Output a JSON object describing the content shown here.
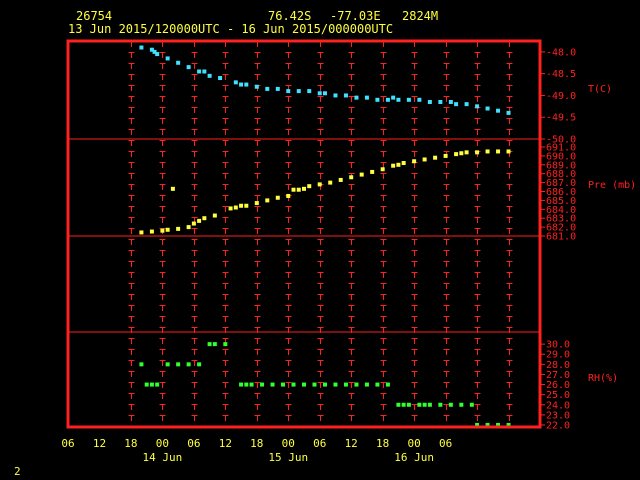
{
  "header": {
    "station_id": "26754",
    "lat": "76.42S",
    "lon": "-77.03E",
    "elev": "2824M",
    "period": "13 Jun 2015/120000UTC - 16 Jun 2015/000000UTC"
  },
  "footer": {
    "page_number": "2"
  },
  "colors": {
    "frame": "#ff2020",
    "grid": "#ff2020",
    "text": "#ffff40",
    "temperature": "#40e0ff",
    "pressure": "#ffff40",
    "rh": "#30ff30"
  },
  "chart_data": [
    {
      "type": "scatter",
      "title": "",
      "ylabel": "T(C)",
      "ylim": [
        -50.0,
        -47.75
      ],
      "y_ticks": [
        "-48.0",
        "-48.5",
        "-49.0",
        "-49.5",
        "-50.0"
      ],
      "color": "#40e0ff",
      "points": [
        [
          14,
          -47.9
        ],
        [
          16,
          -47.95
        ],
        [
          16.5,
          -48.0
        ],
        [
          17,
          -48.05
        ],
        [
          19,
          -48.15
        ],
        [
          21,
          -48.25
        ],
        [
          23,
          -48.35
        ],
        [
          25,
          -48.45
        ],
        [
          26,
          -48.45
        ],
        [
          27,
          -48.55
        ],
        [
          29,
          -48.6
        ],
        [
          32,
          -48.7
        ],
        [
          33,
          -48.75
        ],
        [
          34,
          -48.75
        ],
        [
          36,
          -48.8
        ],
        [
          38,
          -48.85
        ],
        [
          40,
          -48.85
        ],
        [
          42,
          -48.9
        ],
        [
          44,
          -48.9
        ],
        [
          46,
          -48.9
        ],
        [
          48,
          -48.95
        ],
        [
          49,
          -48.95
        ],
        [
          51,
          -49.0
        ],
        [
          53,
          -49.0
        ],
        [
          55,
          -49.05
        ],
        [
          57,
          -49.05
        ],
        [
          59,
          -49.1
        ],
        [
          61,
          -49.1
        ],
        [
          62,
          -49.05
        ],
        [
          63,
          -49.1
        ],
        [
          65,
          -49.1
        ],
        [
          67,
          -49.1
        ],
        [
          69,
          -49.15
        ],
        [
          71,
          -49.15
        ],
        [
          73,
          -49.15
        ],
        [
          74,
          -49.2
        ],
        [
          76,
          -49.2
        ],
        [
          78,
          -49.25
        ],
        [
          80,
          -49.3
        ],
        [
          82,
          -49.35
        ],
        [
          84,
          -49.4
        ]
      ]
    },
    {
      "type": "scatter",
      "title": "",
      "ylabel": "Pre (mb)",
      "ylim": [
        681.0,
        691.9
      ],
      "y_ticks": [
        "691.0",
        "690.0",
        "689.0",
        "688.0",
        "687.0",
        "686.0",
        "685.0",
        "684.0",
        "683.0",
        "682.0",
        "681.0"
      ],
      "color": "#ffff40",
      "points": [
        [
          14,
          681.4
        ],
        [
          16,
          681.5
        ],
        [
          18,
          681.6
        ],
        [
          19,
          681.7
        ],
        [
          21,
          681.8
        ],
        [
          23,
          682.0
        ],
        [
          20,
          686.3
        ],
        [
          24,
          682.4
        ],
        [
          25,
          682.7
        ],
        [
          26,
          683.0
        ],
        [
          28,
          683.3
        ],
        [
          31,
          684.1
        ],
        [
          32,
          684.2
        ],
        [
          33,
          684.4
        ],
        [
          34,
          684.4
        ],
        [
          36,
          684.7
        ],
        [
          38,
          685.0
        ],
        [
          40,
          685.3
        ],
        [
          42,
          685.5
        ],
        [
          43,
          686.2
        ],
        [
          44,
          686.2
        ],
        [
          45,
          686.3
        ],
        [
          46,
          686.6
        ],
        [
          48,
          686.8
        ],
        [
          50,
          687.0
        ],
        [
          52,
          687.3
        ],
        [
          54,
          687.6
        ],
        [
          56,
          687.9
        ],
        [
          58,
          688.2
        ],
        [
          60,
          688.5
        ],
        [
          62,
          688.9
        ],
        [
          63,
          689.0
        ],
        [
          64,
          689.2
        ],
        [
          66,
          689.4
        ],
        [
          68,
          689.6
        ],
        [
          70,
          689.8
        ],
        [
          72,
          690.0
        ],
        [
          74,
          690.2
        ],
        [
          75,
          690.3
        ],
        [
          76,
          690.4
        ],
        [
          78,
          690.4
        ],
        [
          80,
          690.5
        ],
        [
          82,
          690.5
        ],
        [
          84,
          690.5
        ]
      ]
    },
    {
      "type": "scatter",
      "title": "",
      "ylabel": "RH(%)",
      "ylim": [
        21.8,
        31.2
      ],
      "y_ticks": [
        "30.0",
        "29.0",
        "28.0",
        "27.0",
        "26.0",
        "25.0",
        "24.0",
        "23.0",
        "22.0"
      ],
      "color": "#30ff30",
      "points": [
        [
          14,
          28
        ],
        [
          15,
          26
        ],
        [
          16,
          26
        ],
        [
          17,
          26
        ],
        [
          19,
          28
        ],
        [
          21,
          28
        ],
        [
          23,
          28
        ],
        [
          25,
          28
        ],
        [
          27,
          30
        ],
        [
          28,
          30
        ],
        [
          30,
          30
        ],
        [
          33,
          26
        ],
        [
          34,
          26
        ],
        [
          35,
          26
        ],
        [
          37,
          26
        ],
        [
          39,
          26
        ],
        [
          41,
          26
        ],
        [
          43,
          26
        ],
        [
          45,
          26
        ],
        [
          47,
          26
        ],
        [
          49,
          26
        ],
        [
          51,
          26
        ],
        [
          53,
          26
        ],
        [
          55,
          26
        ],
        [
          57,
          26
        ],
        [
          59,
          26
        ],
        [
          61,
          26
        ],
        [
          63,
          24
        ],
        [
          64,
          24
        ],
        [
          65,
          24
        ],
        [
          67,
          24
        ],
        [
          68,
          24
        ],
        [
          69,
          24
        ],
        [
          71,
          24
        ],
        [
          73,
          24
        ],
        [
          75,
          24
        ],
        [
          77,
          24
        ],
        [
          78,
          22
        ],
        [
          80,
          22
        ],
        [
          82,
          22
        ],
        [
          84,
          22
        ]
      ]
    }
  ],
  "x_axis": {
    "xlim": [
      0,
      90
    ],
    "grid_lines": [
      12,
      18,
      24,
      30,
      36,
      42,
      48,
      54,
      60,
      66,
      72,
      78,
      84
    ],
    "tick_labels": [
      {
        "x": 0,
        "text": "06"
      },
      {
        "x": 6,
        "text": "12"
      },
      {
        "x": 12,
        "text": "18"
      },
      {
        "x": 18,
        "text": "00"
      },
      {
        "x": 24,
        "text": "06"
      },
      {
        "x": 30,
        "text": "12"
      },
      {
        "x": 36,
        "text": "18"
      },
      {
        "x": 42,
        "text": "00"
      },
      {
        "x": 48,
        "text": "06"
      },
      {
        "x": 54,
        "text": "12"
      },
      {
        "x": 60,
        "text": "18"
      },
      {
        "x": 66,
        "text": "00"
      },
      {
        "x": 72,
        "text": "06"
      }
    ],
    "day_labels": [
      {
        "x": 18,
        "text": "14 Jun"
      },
      {
        "x": 42,
        "text": "15 Jun"
      },
      {
        "x": 66,
        "text": "16 Jun"
      }
    ]
  }
}
